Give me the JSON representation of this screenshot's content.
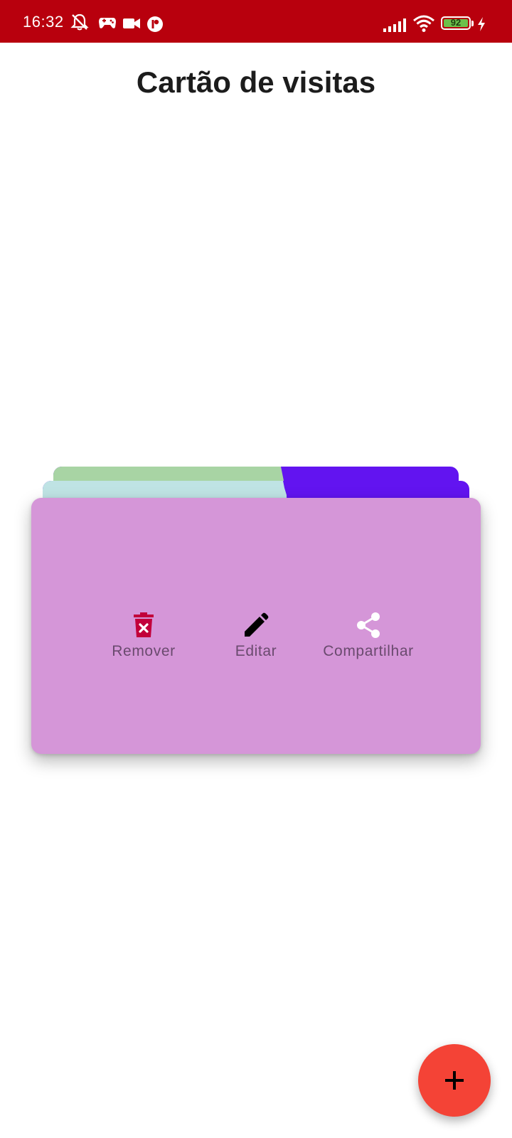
{
  "status_bar": {
    "time": "16:32",
    "battery_level": "92",
    "battery_fraction": 0.92,
    "icons": [
      "muted-bell-icon",
      "game-controller-icon",
      "video-camera-icon",
      "sync-icon",
      "signal-icon",
      "wifi-icon",
      "battery-icon",
      "charging-icon"
    ],
    "background_color": "#b8000d"
  },
  "page": {
    "title": "Cartão de visitas"
  },
  "cards": {
    "back_cards": [
      {
        "left_color": "#a8d4a4",
        "right_color": "#6214f0"
      },
      {
        "left_color": "#bfe3e4",
        "right_color": "#6214f0"
      }
    ],
    "front_card": {
      "color": "#d596d8",
      "actions": [
        {
          "label": "Remover",
          "icon": "delete-icon",
          "icon_color": "#c2003a"
        },
        {
          "label": "Editar",
          "icon": "edit-icon",
          "icon_color": "#000000"
        },
        {
          "label": "Compartilhar",
          "icon": "share-icon",
          "icon_color": "#ffffff"
        }
      ]
    }
  },
  "fab": {
    "icon": "plus-icon",
    "color": "#f44336"
  }
}
